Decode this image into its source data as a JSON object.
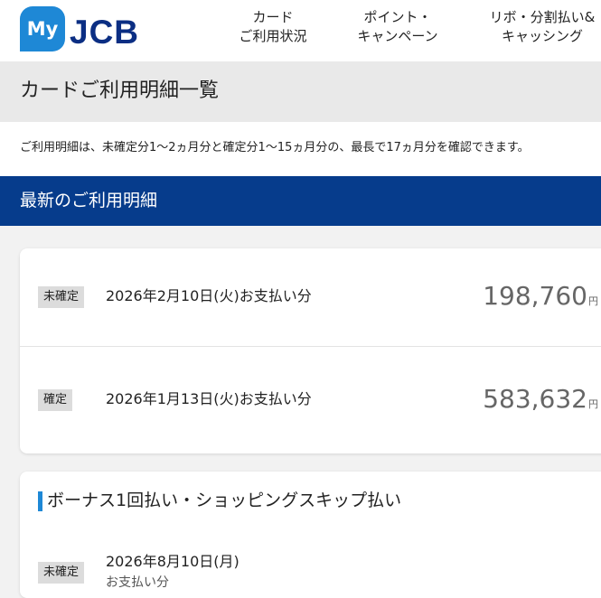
{
  "logo": {
    "my": "My",
    "brand": "JCB"
  },
  "nav": [
    {
      "label": "カード\nご利用状況"
    },
    {
      "label": "ポイント・\nキャンペーン"
    },
    {
      "label": "リボ・分割払い&\nキャッシング"
    }
  ],
  "page_title": "カードご利用明細一覧",
  "notice": "ご利用明細は、未確定分1〜2ヵ月分と確定分1〜15ヵ月分の、最長で17ヵ月分を確認できます。",
  "latest_section_title": "最新のご利用明細",
  "statements": [
    {
      "status": "未確定",
      "payment_date": "2026年2月10日(火)お支払い分",
      "amount": "198,760",
      "unit": "円"
    },
    {
      "status": "確定",
      "payment_date": "2026年1月13日(火)お支払い分",
      "amount": "583,632",
      "unit": "円"
    }
  ],
  "bonus_section": {
    "title": "ボーナス1回払い・ショッピングスキップ払い",
    "status": "未確定",
    "date": "2026年8月10日(月)",
    "sub": "お支払い分"
  },
  "colors": {
    "brand_blue": "#063c8c",
    "accent_blue": "#1e88d6"
  }
}
